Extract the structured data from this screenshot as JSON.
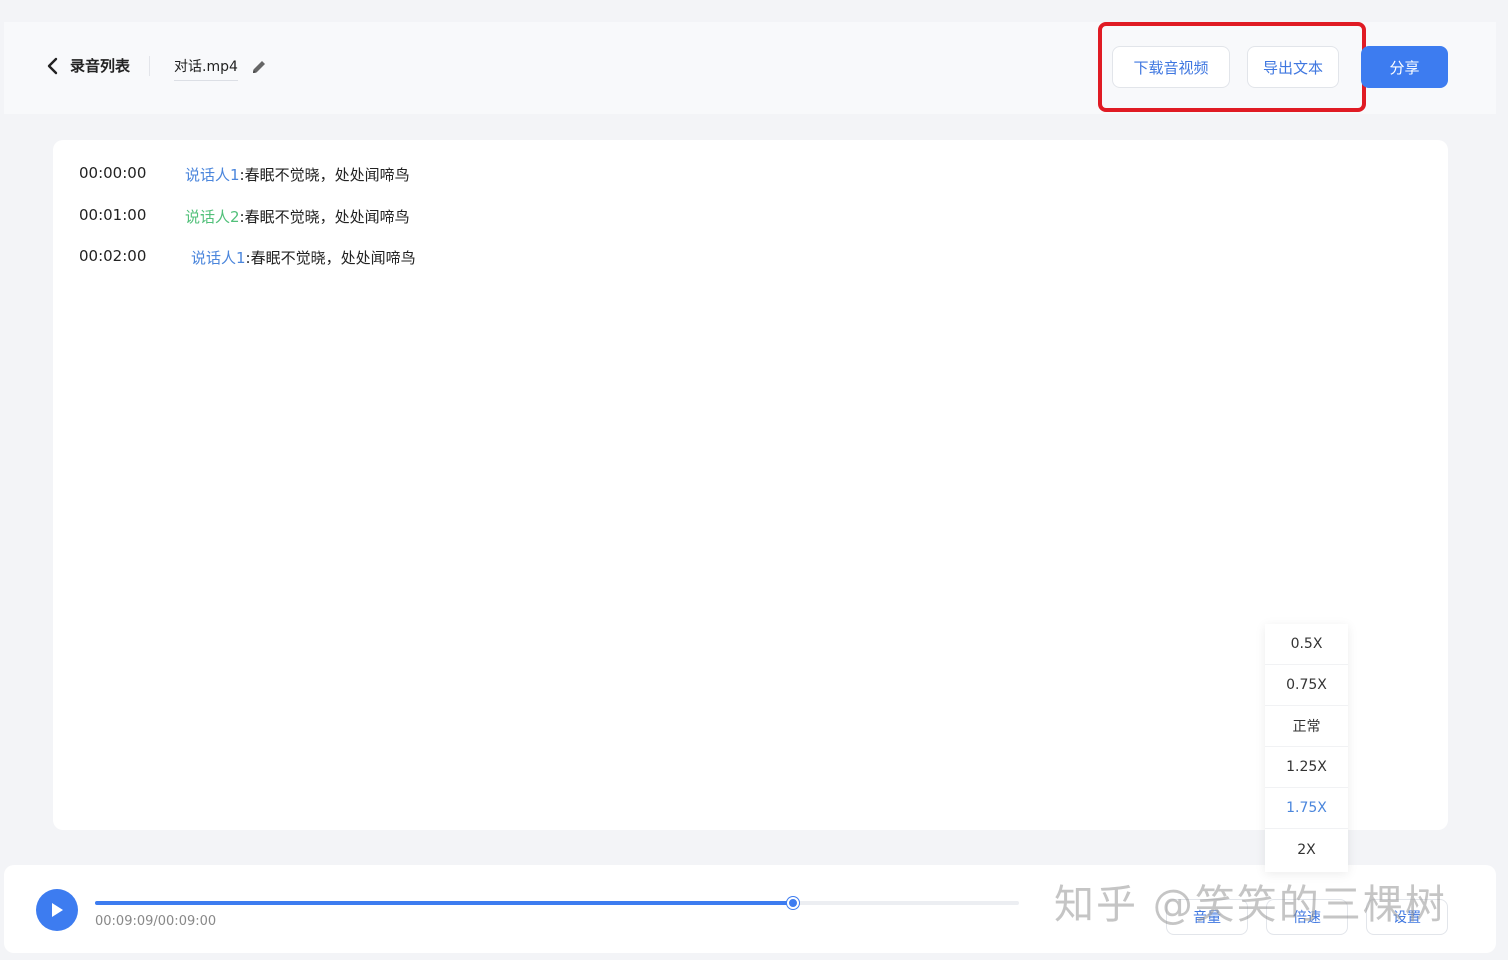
{
  "header": {
    "back_label": "录音列表",
    "filename": "对话.mp4",
    "download_label": "下载音视频",
    "export_label": "导出文本",
    "share_label": "分享"
  },
  "transcript": [
    {
      "time": "00:00:00",
      "speaker": "说话人1",
      "text": ":春眠不觉晓，处处闻啼鸟",
      "speaker_color": "#4b86dc"
    },
    {
      "time": "00:01:00",
      "speaker": "说话人2",
      "text": ":春眠不觉晓，处处闻啼鸟",
      "speaker_color": "#52c07a"
    },
    {
      "time": "00:02:00",
      "speaker": "说话人1",
      "text": ":春眠不觉晓，处处闻啼鸟",
      "speaker_color": "#4b86dc"
    }
  ],
  "speed_menu": {
    "options": [
      "0.5X",
      "0.75X",
      "正常",
      "1.25X",
      "1.75X",
      "2X"
    ],
    "selected": "1.75X"
  },
  "player": {
    "time_readout": "00:09:09/00:09:00",
    "progress_fraction": 0.755,
    "volume_label": "音量",
    "speed_label": "倍速",
    "settings_label": "设置"
  },
  "watermark": "知乎 @笑笑的三棵树",
  "colors": {
    "accent": "#3d7cf0",
    "highlight_box": "#e01b24"
  }
}
